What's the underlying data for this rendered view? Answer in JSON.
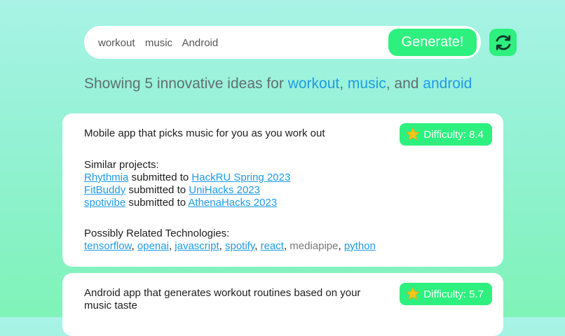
{
  "search": {
    "value": "workout  music  Android",
    "generate_label": "Generate!"
  },
  "headline": {
    "prefix": "Showing 5 innovative ideas for ",
    "keywords": [
      "workout",
      "music",
      "android"
    ],
    "sep1": ", ",
    "sep2": ", and "
  },
  "ideas": [
    {
      "title": "Mobile app that picks music for you as you work out",
      "difficulty": "Difficulty: 8.4",
      "similar_label": "Similar projects:",
      "submitted_to": " submitted to ",
      "similar": [
        {
          "project": "Rhythmia",
          "hackathon": "HackRU Spring 2023"
        },
        {
          "project": "FitBuddy",
          "hackathon": "UniHacks 2023"
        },
        {
          "project": "spotivibe",
          "hackathon": "AthenaHacks 2023"
        }
      ],
      "tech_label": "Possibly Related Technologies:",
      "tech_sep": ", ",
      "technologies": [
        "tensorflow",
        "openai",
        "javascript",
        "spotify",
        "react",
        "mediapipe",
        "python"
      ]
    },
    {
      "title": "Android app that generates workout routines based on your music taste",
      "difficulty": "Difficulty: 5.7"
    }
  ],
  "colors": {
    "accent": "#2ef07e",
    "link": "#1e9be4",
    "star": "#f5c518"
  },
  "icons": {
    "refresh": "refresh-icon",
    "star": "star-icon"
  }
}
